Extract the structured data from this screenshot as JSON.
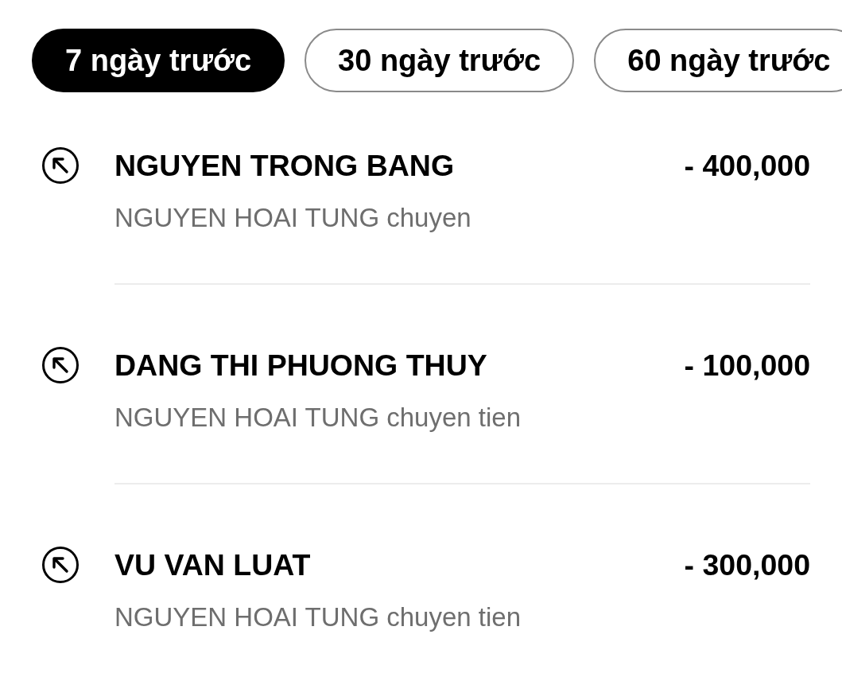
{
  "tabs": [
    {
      "label": "7 ngày trước",
      "selected": true
    },
    {
      "label": "30 ngày trước",
      "selected": false
    },
    {
      "label": "60 ngày trước",
      "selected": false
    }
  ],
  "transactions": [
    {
      "name": "NGUYEN TRONG BANG",
      "description": "NGUYEN HOAI TUNG chuyen",
      "amount": "- 400,000"
    },
    {
      "name": "DANG THI PHUONG THUY",
      "description": "NGUYEN HOAI TUNG chuyen tien",
      "amount": "- 100,000"
    },
    {
      "name": "VU VAN LUAT",
      "description": "NGUYEN HOAI TUNG chuyen tien",
      "amount": "- 300,000"
    }
  ]
}
